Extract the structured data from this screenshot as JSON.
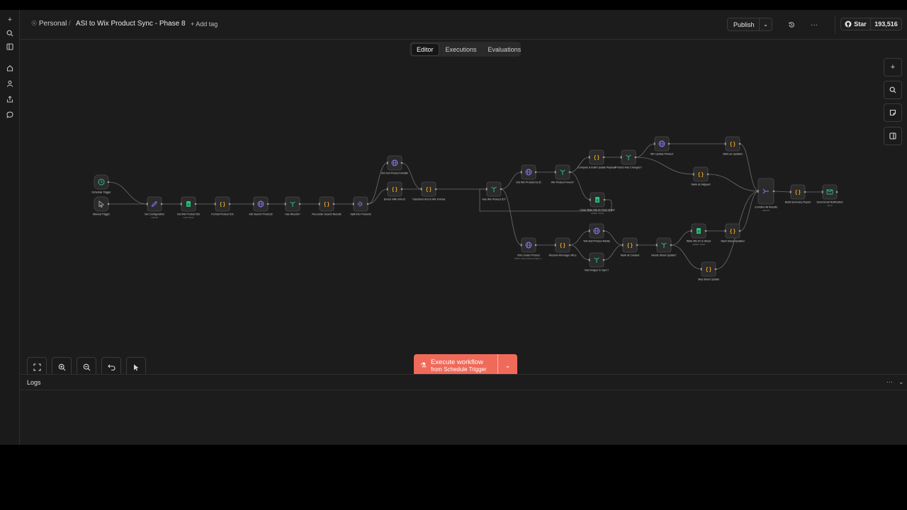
{
  "header": {
    "project": "Personal",
    "separator": "/",
    "workflow_name": "ASI to Wix Product Sync - Phase 8",
    "add_tag": "+ Add tag",
    "publish_label": "Publish",
    "github_star_label": "Star",
    "github_star_count": "193,516"
  },
  "tabs": [
    {
      "label": "Editor",
      "active": true
    },
    {
      "label": "Executions",
      "active": false
    },
    {
      "label": "Evaluations",
      "active": false
    }
  ],
  "execute": {
    "title": "Execute workflow",
    "subtitle": "from Schedule Trigger"
  },
  "logs": {
    "title": "Logs"
  },
  "nodes": [
    {
      "id": "schedule",
      "label": "Schedule Trigger",
      "icon": "clock",
      "color": "#29c27f"
    },
    {
      "id": "manual",
      "label": "Manual Trigger",
      "icon": "cursor",
      "color": "#bdbdbd"
    },
    {
      "id": "setcfg",
      "label": "Set Configuration",
      "sub": "manual",
      "icon": "pen",
      "color": "#8b7bf7"
    },
    {
      "id": "getasi",
      "label": "Get ASI Product IDs",
      "sub": "read: sheet",
      "icon": "sheet",
      "color": "#29c27f"
    },
    {
      "id": "fmtids",
      "label": "Format Product IDs",
      "icon": "code",
      "color": "#f5a623"
    },
    {
      "id": "asisearch",
      "label": "ASI Search Products",
      "icon": "globe",
      "color": "#8b7bf7"
    },
    {
      "id": "hasres",
      "label": "Has Results?",
      "icon": "if",
      "color": "#29c27f"
    },
    {
      "id": "reconcile",
      "label": "Reconcile Search Results",
      "icon": "code",
      "color": "#f5a623"
    },
    {
      "id": "split",
      "label": "Split Into Products",
      "icon": "split",
      "color": "#8b7bf7"
    },
    {
      "id": "asidetails",
      "label": "ASI Get Product Details",
      "icon": "globe",
      "color": "#8b7bf7"
    },
    {
      "id": "enrich",
      "label": "Enrich With Wix ID",
      "icon": "code",
      "color": "#f5a623"
    },
    {
      "id": "transform",
      "label": "Transform ASI to Wix Format",
      "icon": "code",
      "color": "#f5a623"
    },
    {
      "id": "haswixid",
      "label": "Has Wix Product ID?",
      "icon": "if",
      "color": "#29c27f"
    },
    {
      "id": "getwix",
      "label": "Get Wix Product by ID",
      "icon": "globe",
      "color": "#8b7bf7"
    },
    {
      "id": "wixfound",
      "label": "Wix Product Found?",
      "icon": "if",
      "color": "#29c27f"
    },
    {
      "id": "compare",
      "label": "Compare & Build Update Payload",
      "icon": "code",
      "color": "#f5a623"
    },
    {
      "id": "haschanges",
      "label": "Product Has Changes?",
      "icon": "if",
      "color": "#29c27f"
    },
    {
      "id": "wixupdate",
      "label": "Wix Update Product",
      "icon": "globe",
      "color": "#8b7bf7"
    },
    {
      "id": "markupdated",
      "label": "Mark as Updated",
      "icon": "code",
      "color": "#f5a623"
    },
    {
      "id": "markskipped",
      "label": "Mark as Skipped",
      "icon": "code",
      "color": "#f5a623"
    },
    {
      "id": "clearstale",
      "label": "Clear Stale Wix ID From Sheet",
      "sub": "update: sheet",
      "icon": "sheet",
      "color": "#29c27f"
    },
    {
      "id": "wixcreate",
      "label": "Wix Create Product",
      "sub": "POST: https://www.wixapis.c...",
      "icon": "globe",
      "color": "#8b7bf7"
    },
    {
      "id": "resolveimg",
      "label": "Resolve All Image URLs",
      "icon": "code",
      "color": "#f5a623"
    },
    {
      "id": "wixmedia",
      "label": "Wix Add Product Media",
      "icon": "globe",
      "color": "#8b7bf7"
    },
    {
      "id": "hasimages",
      "label": "Has Images to Sync?",
      "icon": "if",
      "color": "#29c27f"
    },
    {
      "id": "markcreated",
      "label": "Mark as Created",
      "icon": "code",
      "color": "#f5a623"
    },
    {
      "id": "needssheet",
      "label": "Needs Sheet Update?",
      "icon": "if",
      "color": "#29c27f"
    },
    {
      "id": "writewix",
      "label": "Write Wix ID to Sheet",
      "sub": "update: sheet",
      "icon": "sheet",
      "color": "#29c27f"
    },
    {
      "id": "marksheet",
      "label": "Mark Sheet Updated",
      "icon": "code",
      "color": "#f5a623"
    },
    {
      "id": "skipsheet",
      "label": "Skip Sheet Update",
      "icon": "code",
      "color": "#f5a623"
    },
    {
      "id": "combine",
      "label": "Combine All Results",
      "sub": "append",
      "icon": "merge",
      "color": "#8b7bf7"
    },
    {
      "id": "summary",
      "label": "Build Summary Report",
      "icon": "code",
      "color": "#f5a623"
    },
    {
      "id": "email",
      "label": "Send Email Notification",
      "sub": "Send",
      "icon": "mail",
      "color": "#29c27f"
    }
  ]
}
